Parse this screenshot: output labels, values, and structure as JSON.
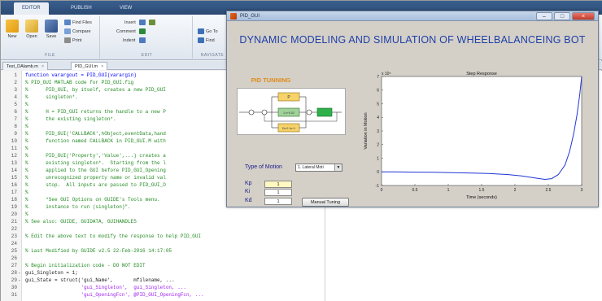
{
  "ribbon": {
    "tabs": [
      "EDITOR",
      "PUBLISH",
      "VIEW"
    ],
    "file_group": {
      "new": "New",
      "open": "Open",
      "save": "Save",
      "find_files": "Find Files",
      "compare": "Compare",
      "print": "Print",
      "label": "FILE"
    },
    "edit_group": {
      "insert": "Insert",
      "comment": "Comment",
      "indent": "Indent",
      "label": "EDIT"
    },
    "navigate_group": {
      "go_to": "Go To",
      "find": "Find",
      "label": "NAVIGATE"
    }
  },
  "file_tabs": [
    {
      "label": "Test_DAlamb.m"
    },
    {
      "label": "PID_GUI.m"
    }
  ],
  "editor": {
    "lines": [
      {
        "n": "1",
        "d": "",
        "text": "function varargout = PID_GUI(varargin)"
      },
      {
        "n": "2",
        "d": "",
        "text": "% PID_GUI MATLAB code for PID_GUI.fig"
      },
      {
        "n": "3",
        "d": "",
        "text": "%      PID_GUI, by itself, creates a new PID_GUI"
      },
      {
        "n": "4",
        "d": "",
        "text": "%      singleton*."
      },
      {
        "n": "5",
        "d": "",
        "text": "%"
      },
      {
        "n": "6",
        "d": "",
        "text": "%      H = PID_GUI returns the handle to a new P"
      },
      {
        "n": "7",
        "d": "",
        "text": "%      the existing singleton*."
      },
      {
        "n": "8",
        "d": "",
        "text": "%"
      },
      {
        "n": "9",
        "d": "",
        "text": "%      PID_GUI('CALLBACK',hObject,eventData,hand"
      },
      {
        "n": "10",
        "d": "",
        "text": "%      function named CALLBACK in PID_GUI.M with"
      },
      {
        "n": "11",
        "d": "",
        "text": "%"
      },
      {
        "n": "12",
        "d": "",
        "text": "%      PID_GUI('Property','Value',...) creates a"
      },
      {
        "n": "13",
        "d": "",
        "text": "%      existing singleton*.  Starting from the l"
      },
      {
        "n": "14",
        "d": "",
        "text": "%      applied to the GUI before PID_GUI_Opening"
      },
      {
        "n": "15",
        "d": "",
        "text": "%      unrecognized property name or invalid val"
      },
      {
        "n": "16",
        "d": "",
        "text": "%      stop.  All inputs are passed to PID_GUI_O"
      },
      {
        "n": "17",
        "d": "",
        "text": "%"
      },
      {
        "n": "18",
        "d": "",
        "text": "%      *See GUI Options on GUIDE's Tools menu."
      },
      {
        "n": "19",
        "d": "",
        "text": "%      instance to run (singleton)\"."
      },
      {
        "n": "20",
        "d": "",
        "text": "%"
      },
      {
        "n": "21",
        "d": "",
        "text": "% See also: GUIDE, GUIDATA, GUIHANDLES"
      },
      {
        "n": "22",
        "d": "",
        "text": ""
      },
      {
        "n": "23",
        "d": "",
        "text": "% Edit the above text to modify the response to help PID_GUI"
      },
      {
        "n": "24",
        "d": "",
        "text": ""
      },
      {
        "n": "25",
        "d": "",
        "text": "% Last Modified by GUIDE v2.5 22-Feb-2016 14:17:05"
      },
      {
        "n": "26",
        "d": "",
        "text": ""
      },
      {
        "n": "27",
        "d": "",
        "text": "% Begin initialization code - DO NOT EDIT"
      },
      {
        "n": "28",
        "d": "-",
        "text": "gui_Singleton = 1;"
      },
      {
        "n": "29",
        "d": "-",
        "text": "gui_State = struct('gui_Name',       mfilename, ..."
      },
      {
        "n": "30",
        "d": "",
        "text": "                   'gui_Singleton',  gui_Singleton, ..."
      },
      {
        "n": "31",
        "d": "",
        "text": "                   'gui_OpeningFcn', @PID_GUI_OpeningFcn, ..."
      }
    ]
  },
  "figure_window": {
    "title": "PID_GUI",
    "heading": "DYNAMIC MODELING AND SIMULATION OF WHEELBALANCEING BOT",
    "pid_tuning_label": "PID TUNNING",
    "block_diagram": {
      "blocks": [
        "P",
        "1 s+0.02",
        "Ds 0.1s+1"
      ],
      "p_block_value": "P"
    },
    "type_of_motion_label": "Type of Motion",
    "type_of_motion_value": "1. Lateral Moti",
    "gains": [
      {
        "name": "Kp",
        "value": "1"
      },
      {
        "name": "Ki",
        "value": "1"
      },
      {
        "name": "Kd",
        "value": "1"
      }
    ],
    "manual_tuning_button": "Manual Tuning"
  },
  "chart_data": {
    "type": "line",
    "title": "Step Response",
    "xlabel": "Time (seconds)",
    "ylabel": "Variation in Motion",
    "y_exponent_label": "x 10⁵",
    "xlim": [
      0,
      3
    ],
    "ylim": [
      -1,
      7
    ],
    "x_ticks": [
      "0",
      "0.5",
      "1",
      "1.5",
      "2",
      "2.5",
      "3"
    ],
    "y_ticks": [
      "-1",
      "0",
      "1",
      "2",
      "3",
      "4",
      "5",
      "6",
      "7"
    ],
    "series": [
      {
        "color": "#1f35d6",
        "x": [
          0,
          0.2,
          0.5,
          0.8,
          1.0,
          1.3,
          1.6,
          1.9,
          2.1,
          2.3,
          2.45,
          2.55,
          2.65,
          2.75,
          2.82,
          2.88,
          2.93,
          2.97,
          3.0
        ],
        "y": [
          0.0,
          0.0,
          -0.02,
          -0.03,
          -0.05,
          -0.08,
          -0.12,
          -0.2,
          -0.3,
          -0.45,
          -0.55,
          -0.5,
          -0.2,
          0.5,
          1.5,
          2.8,
          4.2,
          5.6,
          7.0
        ]
      }
    ]
  }
}
